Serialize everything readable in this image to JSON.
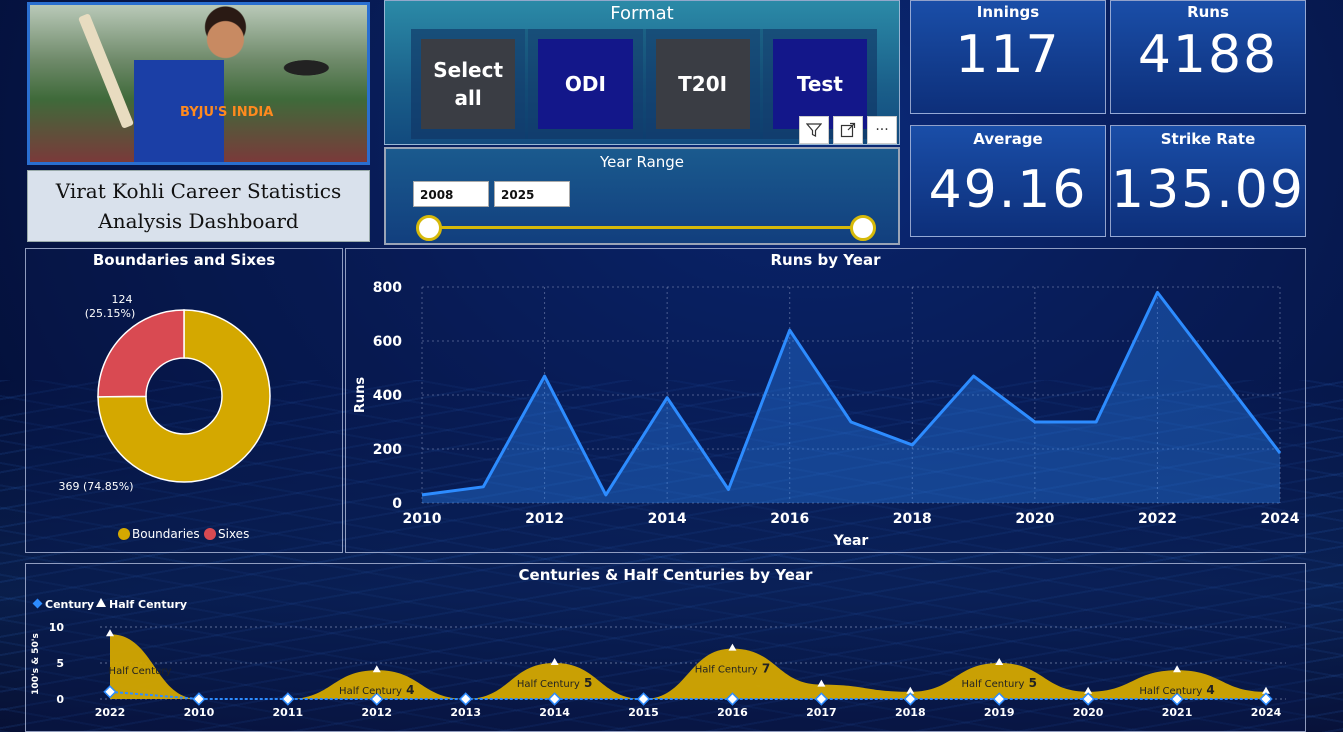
{
  "header": {
    "dashboard_title": "Virat Kohli Career Statistics Analysis Dashboard",
    "photo_jersey_text": "BYJU'S INDIA"
  },
  "format_slicer": {
    "title": "Format",
    "options": [
      "Select all",
      "ODI",
      "T20I",
      "Test"
    ]
  },
  "toolbar": {
    "filter_icon": "filter-icon",
    "focus_icon": "focus-mode-icon",
    "more_icon": "more-options-icon",
    "more_label": "···"
  },
  "year_range": {
    "title": "Year Range",
    "start": "2008",
    "end": "2025"
  },
  "kpis": {
    "innings": {
      "label": "Innings",
      "value": "117"
    },
    "runs": {
      "label": "Runs",
      "value": "4188"
    },
    "average": {
      "label": "Average",
      "value": "49.16"
    },
    "strike_rate": {
      "label": "Strike Rate",
      "value": "135.09"
    }
  },
  "colors": {
    "boundaries": "#d4a800",
    "sixes": "#d94a52",
    "runs_line": "#2d8cff",
    "century": "#2d8cff",
    "half_century_fill": "#d4a800"
  },
  "chart_data": [
    {
      "type": "pie",
      "title": "Boundaries and Sixes",
      "categories": [
        "Boundaries",
        "Sixes"
      ],
      "values": [
        369,
        124
      ],
      "data_labels": [
        "369 (74.85%)",
        "124 (25.15%)"
      ],
      "legend": [
        "Boundaries",
        "Sixes"
      ],
      "donut": true
    },
    {
      "type": "area",
      "title": "Runs by Year",
      "xlabel": "Year",
      "ylabel": "Runs",
      "x": [
        2010,
        2011,
        2012,
        2013,
        2014,
        2015,
        2016,
        2017,
        2018,
        2019,
        2020,
        2021,
        2022,
        2024
      ],
      "values": [
        30,
        60,
        470,
        30,
        390,
        50,
        640,
        300,
        215,
        470,
        300,
        300,
        780,
        185
      ],
      "x_ticks": [
        "2010",
        "2012",
        "2014",
        "2016",
        "2018",
        "2020",
        "2022",
        "2024"
      ],
      "y_ticks": [
        "0",
        "200",
        "400",
        "600",
        "800"
      ],
      "ylim": [
        0,
        800
      ],
      "xlim": [
        2010,
        2024
      ],
      "grid": true
    },
    {
      "type": "area",
      "title": "Centuries & Half Centuries by Year",
      "ylabel": "100's & 50's",
      "categories": [
        "2022",
        "2010",
        "2011",
        "2012",
        "2013",
        "2014",
        "2015",
        "2016",
        "2017",
        "2018",
        "2019",
        "2020",
        "2021",
        "2024"
      ],
      "series": [
        {
          "name": "Century",
          "values": [
            1,
            0,
            0,
            0,
            0,
            0,
            0,
            0,
            0,
            0,
            0,
            0,
            0,
            0
          ]
        },
        {
          "name": "Half Century",
          "values": [
            9,
            0,
            0,
            4,
            0,
            5,
            0,
            7,
            2,
            1,
            5,
            1,
            4,
            1
          ]
        }
      ],
      "data_labels": [
        "Half Century",
        "Half Century 4",
        "Half Century 5",
        "Half Century 7",
        "Half Century 5",
        "Half Century 4"
      ],
      "y_ticks": [
        "0",
        "5",
        "10"
      ],
      "ylim": [
        0,
        10
      ],
      "legend": [
        "Century",
        "Half Century"
      ],
      "legend_position": "top-left",
      "grid": true
    }
  ]
}
